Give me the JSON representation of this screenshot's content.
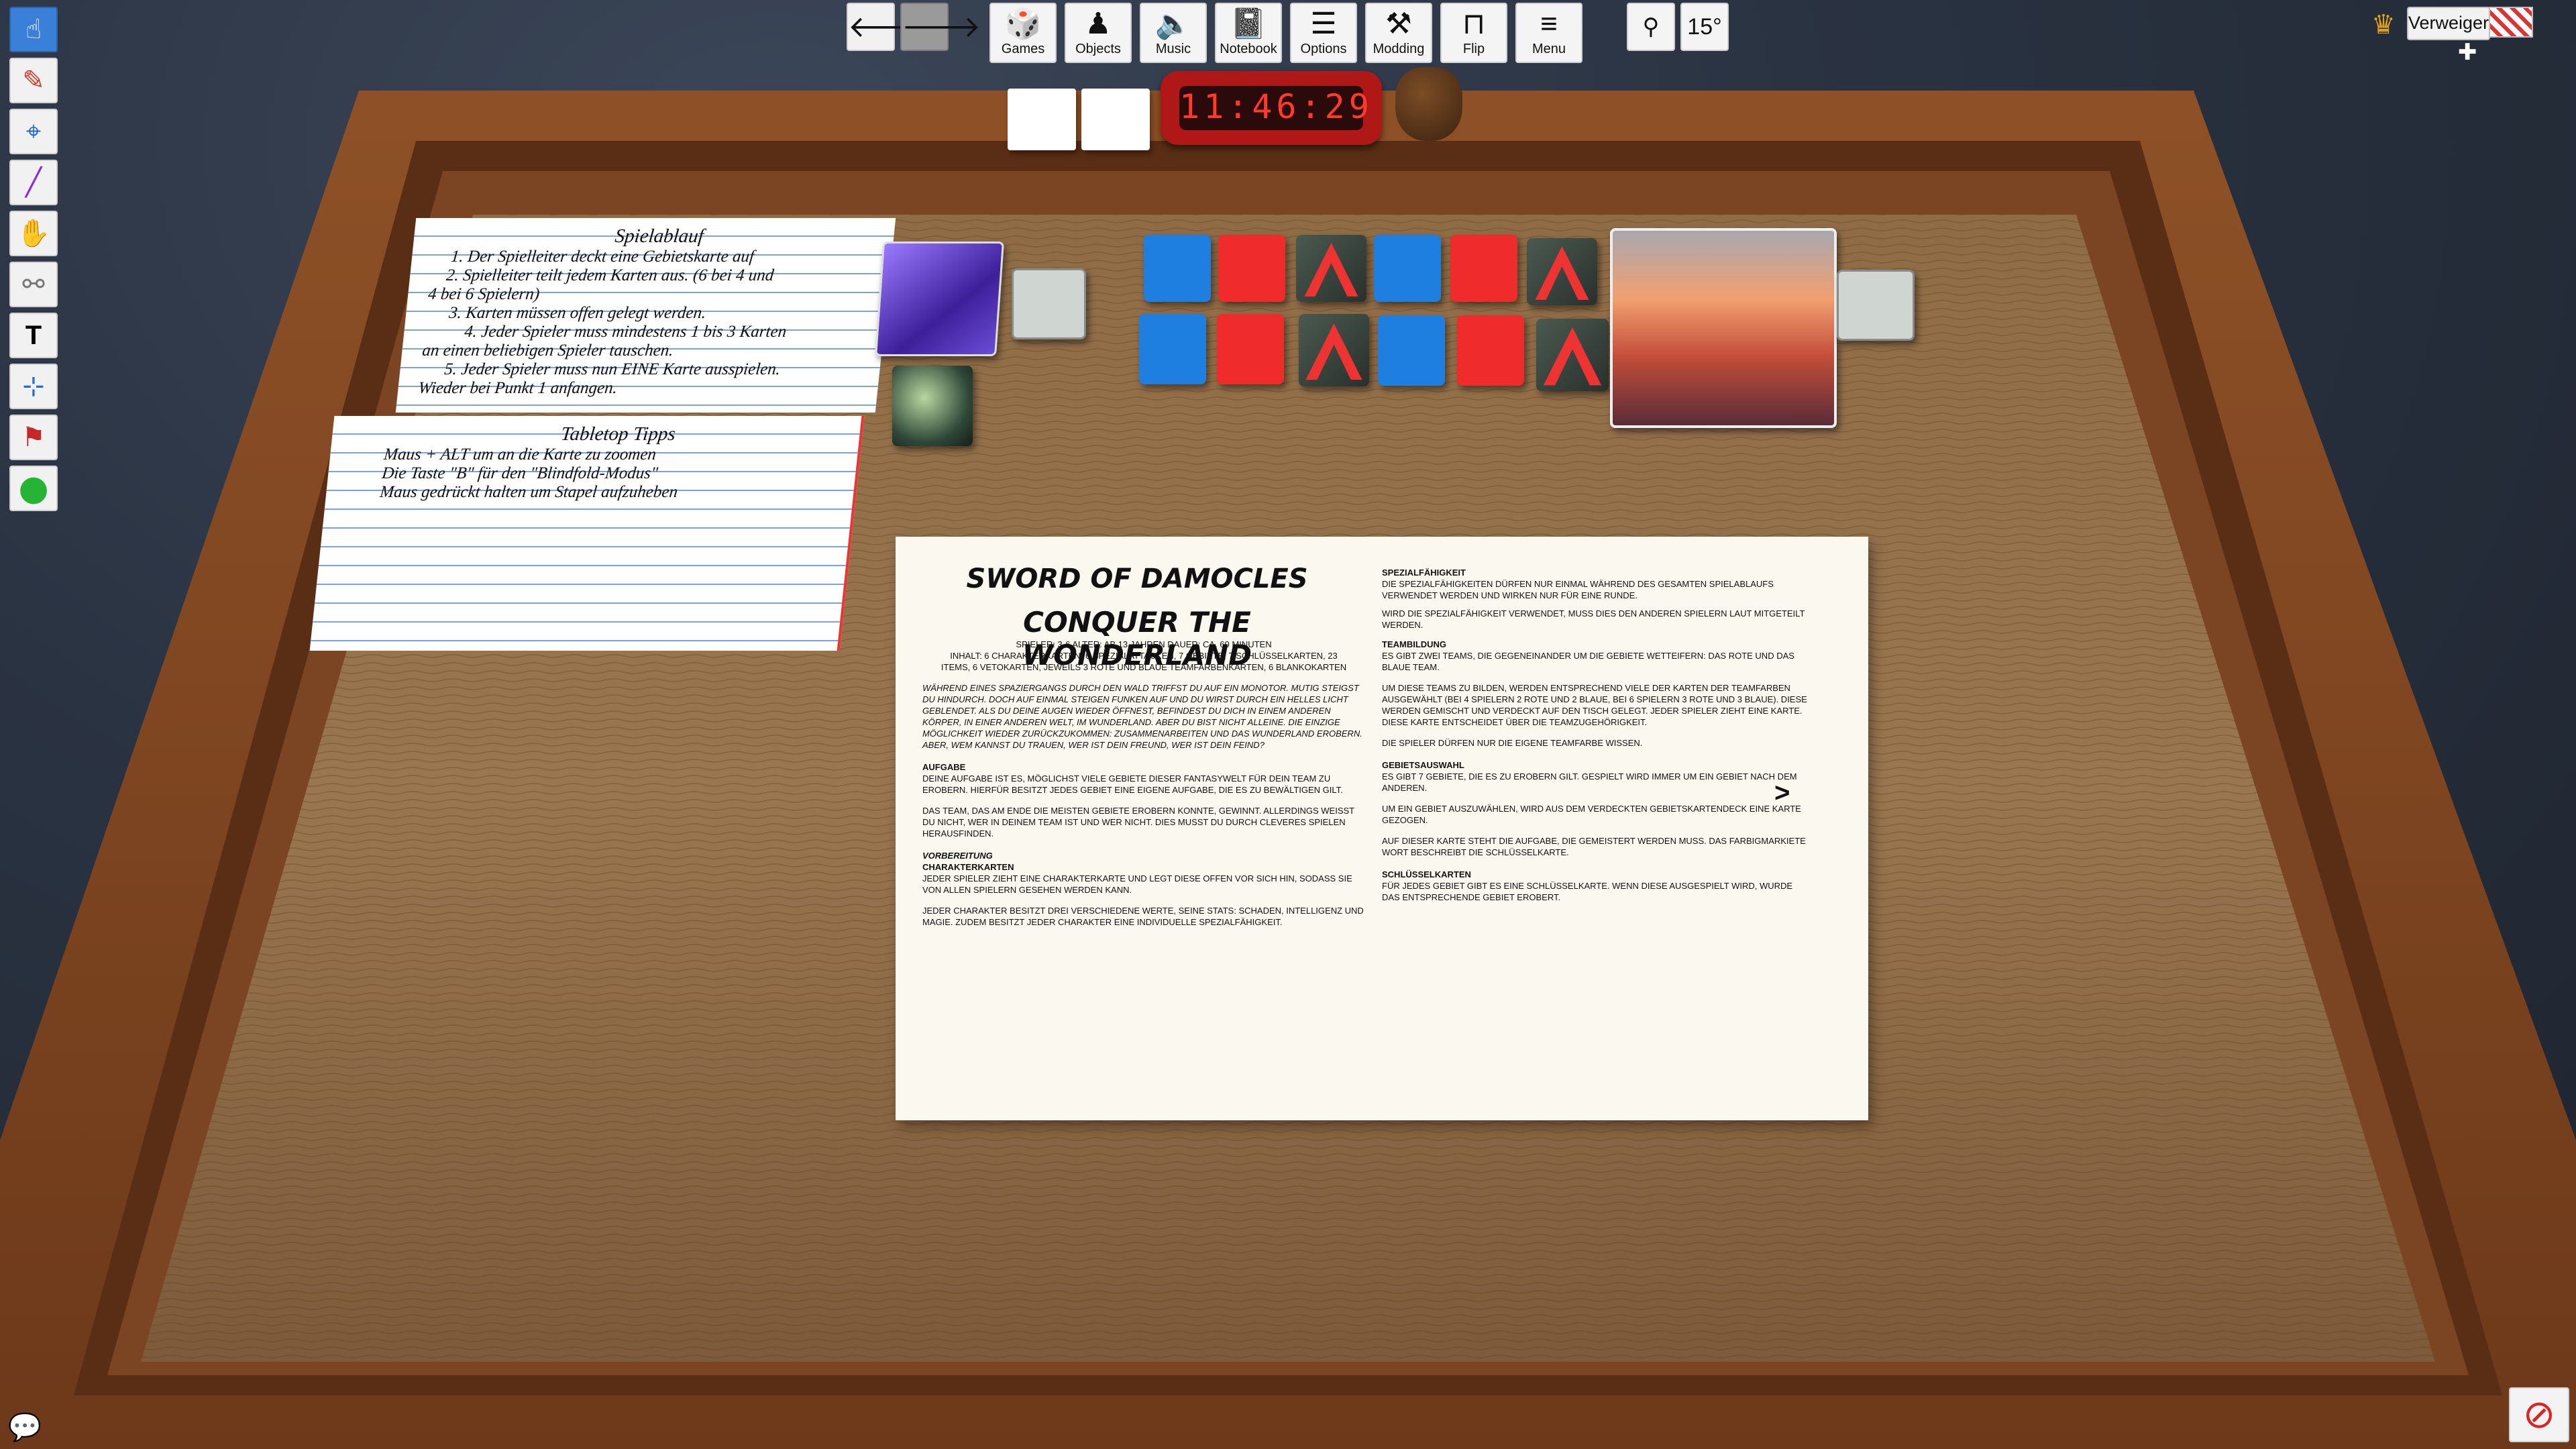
{
  "toolbar": {
    "nav": [
      {
        "icon": "arrow-left-icon",
        "glyph": "🡐"
      },
      {
        "icon": "arrow-right-icon",
        "glyph": "🡒"
      }
    ],
    "buttons": [
      {
        "label": "Games",
        "icon": "dice-icon",
        "glyph": "🎲"
      },
      {
        "label": "Objects",
        "icon": "pawn-icon",
        "glyph": "♟"
      },
      {
        "label": "Music",
        "icon": "speaker-icon",
        "glyph": "🔈"
      },
      {
        "label": "Notebook",
        "icon": "notebook-icon",
        "glyph": "📓"
      },
      {
        "label": "Options",
        "icon": "sliders-icon",
        "glyph": "☰"
      },
      {
        "label": "Modding",
        "icon": "tools-icon",
        "glyph": "⚒"
      },
      {
        "label": "Flip",
        "icon": "flip-table-icon",
        "glyph": "⊓"
      },
      {
        "label": "Menu",
        "icon": "menu-icon",
        "glyph": "≡"
      }
    ],
    "gravity_icon": "gravity-icon",
    "gravity_glyph": "⚲",
    "rotation": "15°"
  },
  "player": {
    "name": "Verweigert!",
    "crown_glyph": "♛",
    "add_glyph": "✚"
  },
  "left_tools": [
    {
      "icon": "pointer-hand-icon",
      "glyph": "☝"
    },
    {
      "icon": "pen-icon",
      "glyph": "✎"
    },
    {
      "icon": "map-pin-icon",
      "glyph": "⌖"
    },
    {
      "icon": "line-icon",
      "glyph": "╱"
    },
    {
      "icon": "flick-icon",
      "glyph": "✋"
    },
    {
      "icon": "joint-icon",
      "glyph": "⚯"
    },
    {
      "icon": "text-tool-icon",
      "glyph": "T"
    },
    {
      "icon": "gizmo-icon",
      "glyph": "⊹"
    },
    {
      "icon": "stamp-icon",
      "glyph": "⚑"
    },
    {
      "icon": "green-ball-icon",
      "glyph": "●"
    }
  ],
  "clock": "11:46:29",
  "spielablauf": {
    "title": "Spielablauf",
    "lines": [
      "1. Der Spielleiter deckt eine Gebietskarte auf",
      "2. Spielleiter teilt jedem Karten aus. (6 bei 4 und",
      "4 bei 6 Spielern)",
      "3. Karten müssen offen gelegt werden.",
      "4. Jeder Spieler muss mindestens 1 bis 3 Karten",
      "an einen beliebigen Spieler tauschen.",
      "5. Jeder Spieler muss nun EINE Karte ausspielen.",
      "",
      "Wieder bei Punkt 1 anfangen."
    ]
  },
  "tipps": {
    "title": "Tabletop Tipps",
    "lines": [
      "Maus + ALT um an die Karte zu zoomen",
      "Die Taste \"B\" für den \"Blindfold-Modus\"",
      "Maus gedrückt halten um Stapel aufzuheben"
    ]
  },
  "rulebook": {
    "title1": "SWORD OF DAMOCLES",
    "title2": "CONQUER THE WONDERLAND",
    "meta1": "SPIELER: 3-6    ALTER: AB 13 JAHREN    DAUER: CA. 60 MINUTEN",
    "meta2": "INHALT: 6 CHARAKTERKARTEN, 6 SPEZIALATTACKEN, 7 GEBIETE, 7 SCHLÜSSELKARTEN, 23",
    "meta3": "ITEMS, 6 VETOKARTEN, JEWEILS 3 ROTE UND BLAUE TEAMFARBENKARTEN, 6 BLANKOKARTEN",
    "intro": "WÄHREND EINES SPAZIERGANGS DURCH DEN WALD TRIFFST DU AUF EIN MONOTOR. MUTIG STEIGST DU HINDURCH. DOCH AUF EINMAL STEIGEN FUNKEN AUF UND DU WIRST DURCH EIN HELLES LICHT GEBLENDET. ALS DU DEINE AUGEN WIEDER ÖFFNEST, BEFINDEST DU DICH IN EINEM ANDEREN KÖRPER, IN EINER ANDEREN WELT, IM WUNDERLAND. ABER DU BIST NICHT ALLEINE. DIE EINZIGE MÖGLICHKEIT WIEDER ZURÜCKZUKOMMEN: ZUSAMMENARBEITEN UND DAS WUNDERLAND EROBERN. ABER, WEM KANNST DU TRAUEN, WER IST DEIN FREUND, WER IST DEIN FEIND?",
    "aufgabe_h": "AUFGABE",
    "aufgabe": "DEINE AUFGABE IST ES, MÖGLICHST VIELE GEBIETE DIESER FANTASYWELT FÜR DEIN TEAM ZU EROBERN. HIERFÜR BESITZT JEDES GEBIET EINE EIGENE AUFGABE, DIE ES ZU BEWÄLTIGEN GILT.",
    "team": "DAS TEAM, DAS AM ENDE DIE MEISTEN GEBIETE EROBERN KONNTE, GEWINNT. ALLERDINGS WEISST DU NICHT, WER IN DEINEM TEAM IST UND WER NICHT. DIES MUSST DU DURCH CLEVERES SPIELEN HERAUSFINDEN.",
    "vorb_h": "VORBEREITUNG",
    "chark_h": "CHARAKTERKARTEN",
    "chark": "JEDER SPIELER ZIEHT EINE CHARAKTERKARTE UND LEGT DIESE OFFEN VOR SICH HIN, SODASS SIE VON ALLEN SPIELERN GESEHEN WERDEN KANN.",
    "stats": "JEDER CHARAKTER BESITZT DREI VERSCHIEDENE WERTE, SEINE STATS: SCHADEN, INTELLIGENZ UND MAGIE. ZUDEM BESITZT JEDER CHARAKTER EINE INDIVIDUELLE SPEZIALFÄHIGKEIT.",
    "spez_h": "SPEZIALFÄHIGKEIT",
    "spez": "DIE SPEZIALFÄHIGKEITEN DÜRFEN NUR EINMAL WÄHREND DES GESAMTEN SPIELABLAUFS VERWENDET WERDEN UND WIRKEN NUR FÜR EINE RUNDE.",
    "spez2": "WIRD DIE SPEZIALFÄHIGKEIT VERWENDET, MUSS DIES DEN ANDEREN SPIELERN LAUT MITGETEILT WERDEN.",
    "teamb_h": "TEAMBILDUNG",
    "teamb": "ES GIBT ZWEI TEAMS, DIE GEGENEINANDER UM DIE GEBIETE WETTEIFERN: DAS ROTE UND DAS BLAUE TEAM.",
    "teamb2": "UM DIESE TEAMS ZU BILDEN, WERDEN ENTSPRECHEND VIELE DER KARTEN DER TEAMFARBEN AUSGEWÄHLT (BEI 4 SPIELERN 2 ROTE UND 2 BLAUE, BEI 6 SPIELERN 3 ROTE UND 3 BLAUE). DIESE WERDEN GEMISCHT UND VERDECKT AUF DEN TISCH GELEGT. JEDER SPIELER ZIEHT EINE KARTE. DIESE KARTE ENTSCHEIDET ÜBER DIE TEAMZUGEHÖRIGKEIT.",
    "teamb3": "DIE SPIELER DÜRFEN NUR DIE EIGENE TEAMFARBE WISSEN.",
    "gebiet_h": "GEBIETSAUSWAHL",
    "gebiet": "ES GIBT 7 GEBIETE, DIE ES ZU EROBERN GILT. GESPIELT WIRD IMMER UM EIN GEBIET NACH DEM ANDEREN.",
    "gebiet2": "UM EIN GEBIET AUSZUWÄHLEN, WIRD AUS DEM VERDECKTEN GEBIETSKARTENDECK EINE KARTE GEZOGEN.",
    "gebiet3": "AUF DIESER KARTE STEHT DIE AUFGABE, DIE GEMEISTERT WERDEN MUSS. DAS FARBIGMARKIETE WORT BESCHREIBT DIE SCHLÜSSELKARTE.",
    "schl_h": "SCHLÜSSELKARTEN",
    "schl": "FÜR JEDES GEBIET GIBT ES EINE SCHLÜSSELKARTE. WENN DIESE AUSGESPIELT WIRD, WURDE DAS ENTSPRECHENDE GEBIET EROBERT.",
    "next": ">"
  },
  "colors": {
    "team_blue": "#1e7fe0",
    "team_red": "#ef2b2b",
    "wood": "#8e6a45",
    "frame": "#7a4220"
  },
  "bottom": {
    "chat_icon": "chat-bubble-icon",
    "chat_glyph": "💬",
    "no_entry_icon": "no-entry-icon",
    "no_entry_glyph": "⊘"
  }
}
